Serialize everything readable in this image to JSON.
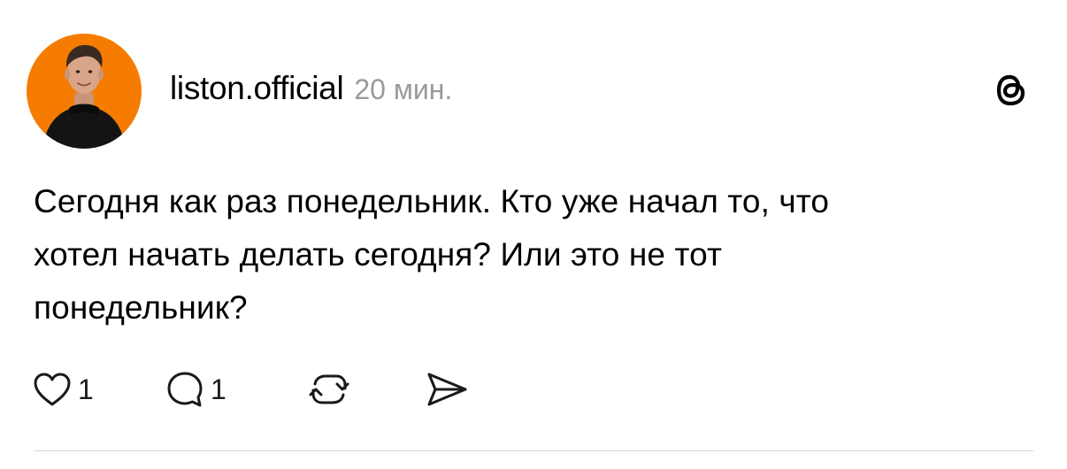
{
  "post": {
    "username": "liston.official",
    "timestamp": "20 мин.",
    "text": "Сегодня как раз понедельник. Кто уже начал то, что хотел начать делать сегодня? Или это не тот понедельник?",
    "text_lines": [
      "Сегодня как раз понедельник. Кто уже начал то, что",
      "хотел начать делать сегодня? Или это не тот",
      "понедельник?"
    ],
    "avatar_background": "#f57c00"
  },
  "actions": {
    "like_icon": "heart-icon",
    "like_count": "1",
    "comment_icon": "speech-bubble-icon",
    "comment_count": "1",
    "repost_icon": "repost-icon",
    "share_icon": "paper-plane-icon"
  },
  "header": {
    "app_icon": "threads-logo-icon"
  }
}
